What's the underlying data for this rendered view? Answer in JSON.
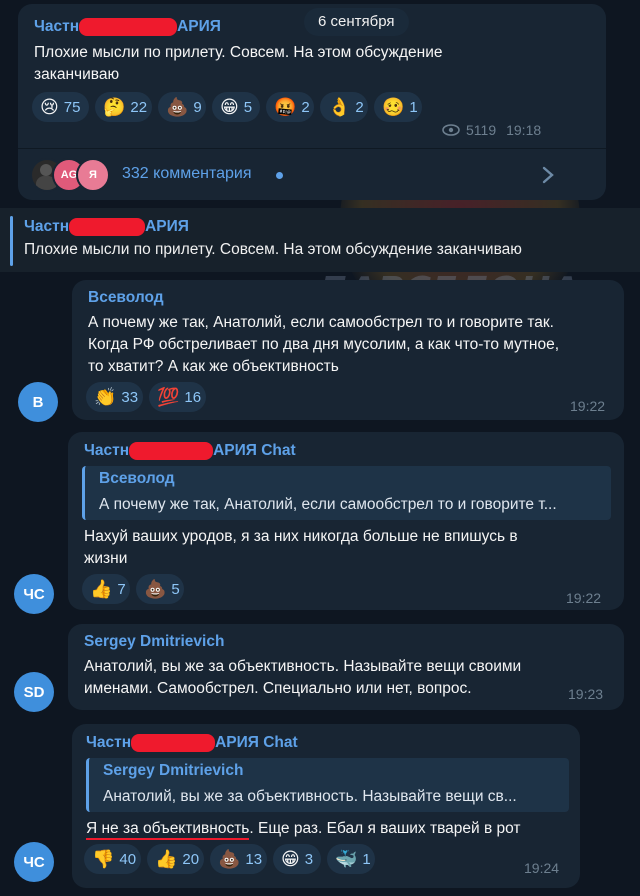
{
  "date_badge": "6 сентября",
  "watermark": {
    "line1": "ТРУХА",
    "line2": "БАРСЕЛОНА"
  },
  "post": {
    "author_prefix": "Частн",
    "author_suffix": "АРИЯ",
    "text_line1": "Плохие мысли по прилету. Совсем. На этом обсуждение",
    "text_line2": "заканчиваю",
    "reactions": [
      {
        "icon": "crying-face",
        "emoji": "😢",
        "count": "75"
      },
      {
        "icon": "thinking-face",
        "emoji": "🤔",
        "count": "22"
      },
      {
        "icon": "poo",
        "emoji": "💩",
        "count": "9"
      },
      {
        "icon": "grinning-face",
        "emoji": "😁",
        "count": "5"
      },
      {
        "icon": "cursing-face",
        "emoji": "🤬",
        "count": "2"
      },
      {
        "icon": "ok-hand",
        "emoji": "👌",
        "count": "2"
      },
      {
        "icon": "woozy-face",
        "emoji": "🥴",
        "count": "1"
      }
    ],
    "views": "5119",
    "time": "19:18",
    "comments_label": "332 комментария",
    "commenter_avatars": [
      "",
      "AG",
      "Я"
    ]
  },
  "pinned": {
    "author_prefix": "Частн",
    "author_suffix": "АРИЯ",
    "text": "Плохие мысли по прилету. Совсем. На этом обсуждение заканчиваю"
  },
  "messages": [
    {
      "author": "Всеволод",
      "lines": [
        "А почему же так, Анатолий, если самообстрел то и говорите так.",
        "Когда РФ обстреливает по два дня мусолим, а как что-то мутное,",
        "то хватит? А как же объективность"
      ],
      "reactions": [
        {
          "icon": "clapping-hands",
          "emoji": "👏",
          "count": "33"
        },
        {
          "icon": "hundred-points",
          "emoji": "💯",
          "count": "16"
        }
      ],
      "time": "19:22",
      "avatar": "В",
      "avatar_color": "#3f8fdc"
    },
    {
      "author_prefix": "Частн",
      "author_suffix": "АРИЯ Chat",
      "quote_author": "Всеволод",
      "quote_text": "А почему же так, Анатолий, если самообстрел то и говорите т...",
      "lines": [
        "Нахуй ваших уродов, я за них никогда больше не впишусь в",
        "жизни"
      ],
      "reactions": [
        {
          "icon": "thumbs-up",
          "emoji": "👍",
          "count": "7"
        },
        {
          "icon": "poo",
          "emoji": "💩",
          "count": "5"
        }
      ],
      "time": "19:22",
      "avatar": "ЧС",
      "avatar_color": "#3f8fdc"
    },
    {
      "author": "Sergey Dmitrievich",
      "lines": [
        "Анатолий, вы же за объективность. Называйте вещи своими",
        "именами. Самообстрел. Специально или нет, вопрос."
      ],
      "time": "19:23",
      "avatar": "SD",
      "avatar_color": "#3f8fdc"
    },
    {
      "author_prefix": "Частн",
      "author_suffix": "АРИЯ Chat",
      "quote_author": "Sergey Dmitrievich",
      "quote_text": "Анатолий, вы же за объективность. Называйте вещи св...",
      "text_underlined": "Я не за объективность",
      "text_rest": ". Еще раз. Ебал я ваших тварей в рот",
      "reactions": [
        {
          "icon": "thumbs-down",
          "emoji": "👎",
          "count": "40"
        },
        {
          "icon": "thumbs-up",
          "emoji": "👍",
          "count": "20"
        },
        {
          "icon": "poo",
          "emoji": "💩",
          "count": "13"
        },
        {
          "icon": "grinning-face",
          "emoji": "😁",
          "count": "3"
        },
        {
          "icon": "whale",
          "emoji": "🐳",
          "count": "1"
        }
      ],
      "time": "19:24",
      "avatar": "ЧС",
      "avatar_color": "#3f8fdc"
    }
  ],
  "colors": {
    "background": "#0e1621",
    "bubble": "#182533",
    "accent": "#5ea1e8",
    "redaction": "#ef1a2d"
  }
}
